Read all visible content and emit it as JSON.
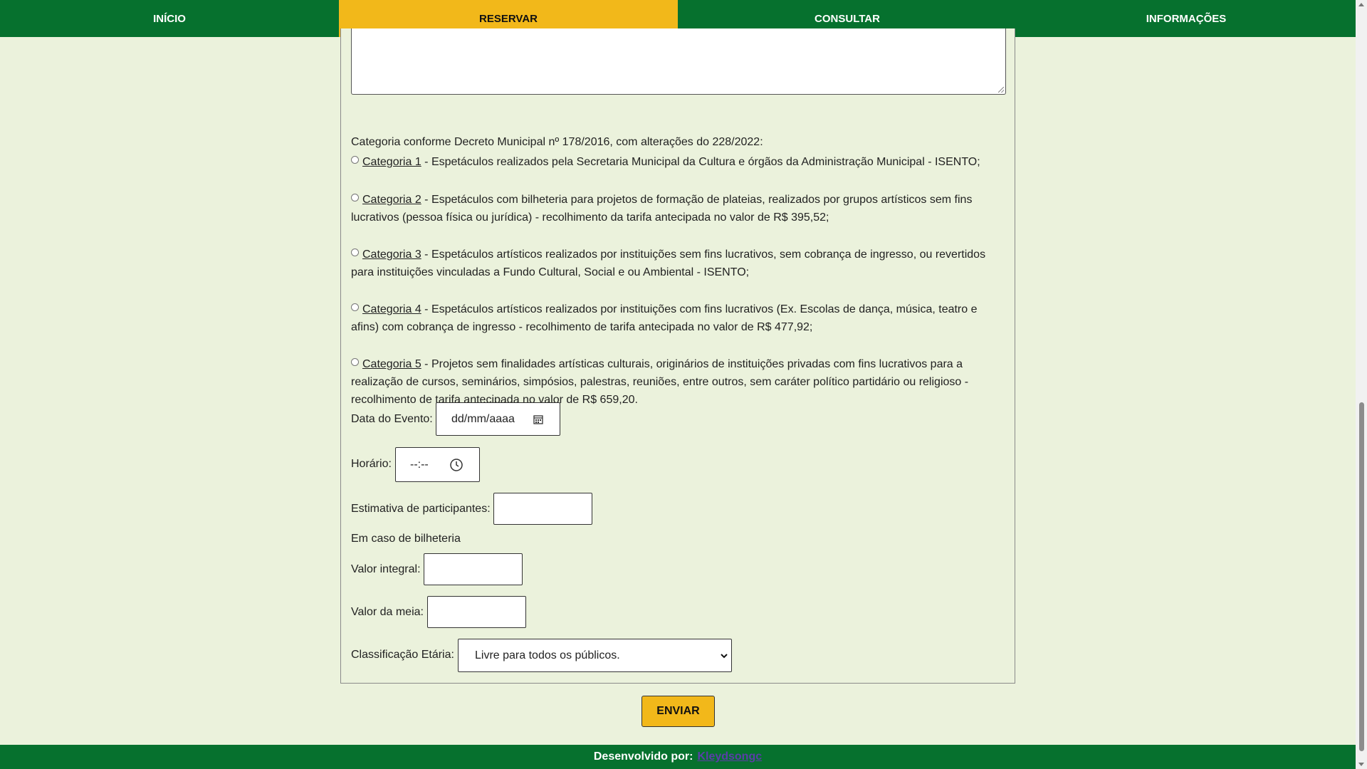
{
  "nav": {
    "items": [
      {
        "label": "INÍCIO"
      },
      {
        "label": "RESERVAR"
      },
      {
        "label": "CONSULTAR"
      },
      {
        "label": "INFORMAÇÕES"
      }
    ],
    "active_index": 1
  },
  "form": {
    "category_intro": "Categoria conforme Decreto Municipal nº 178/2016, com alterações do 228/2022:",
    "categories": [
      {
        "name": "Categoria 1",
        "text": " - Espetáculos realizados pela Secretaria Municipal da Cultura e órgãos da Administração Municipal - ISENTO;"
      },
      {
        "name": "Categoria 2",
        "text": " - Espetáculos com bilheteria para projetos de formação de plateias, realizados por grupos artísticos sem fins lucrativos (pessoa física ou jurídica) - recolhimento da tarifa antecipada no valor de R$ 395,52;"
      },
      {
        "name": "Categoria 3",
        "text": " - Espetáculos artísticos realizados por instituições sem fins lucrativos, sem cobrança de ingresso, ou revertidos para instituições vinculadas a Fundo Cultural, Social e ou Ambiental - ISENTO;"
      },
      {
        "name": "Categoria 4",
        "text": " - Espetáculos artísticos realizados por instituições com fins lucrativos (Ex. Escolas de dança, música, teatro e afins) com cobrança de ingresso - recolhimento de tarifa antecipada no valor de R$ 477,92;"
      },
      {
        "name": "Categoria 5",
        "text": " - Projetos sem finalidades artísticas culturais, originários de instituições privadas com fins lucrativos para a realização de cursos, seminários, simpósios, palestras, reuniões, entre outros, sem caráter político partidário ou religioso - recolhimento de tarifa antecipada no valor de R$ 659,20."
      }
    ],
    "date_label": "Data do Evento:",
    "date_placeholder": "dd/mm/aaaa",
    "time_label": "Horário:",
    "time_placeholder": "--:--",
    "participants_label": "Estimativa de participantes:",
    "participants_value": "",
    "ticket_heading": "Em caso de bilheteria",
    "full_price_label": "Valor integral:",
    "full_price_value": "",
    "half_price_label": "Valor da meia:",
    "half_price_value": "",
    "rating_label": "Classificação Etária:",
    "rating_selected": "Livre para todos os públicos.",
    "submit_label": "ENVIAR"
  },
  "footer": {
    "prefix": "Desenvolvido por:",
    "link": "Kleydsongc"
  },
  "colors": {
    "nav_bg": "#06712e",
    "accent": "#f2b81a",
    "page_bg": "#ebf2dc"
  },
  "icons": [
    "calendar-icon",
    "clock-icon",
    "chevron-down-icon"
  ]
}
